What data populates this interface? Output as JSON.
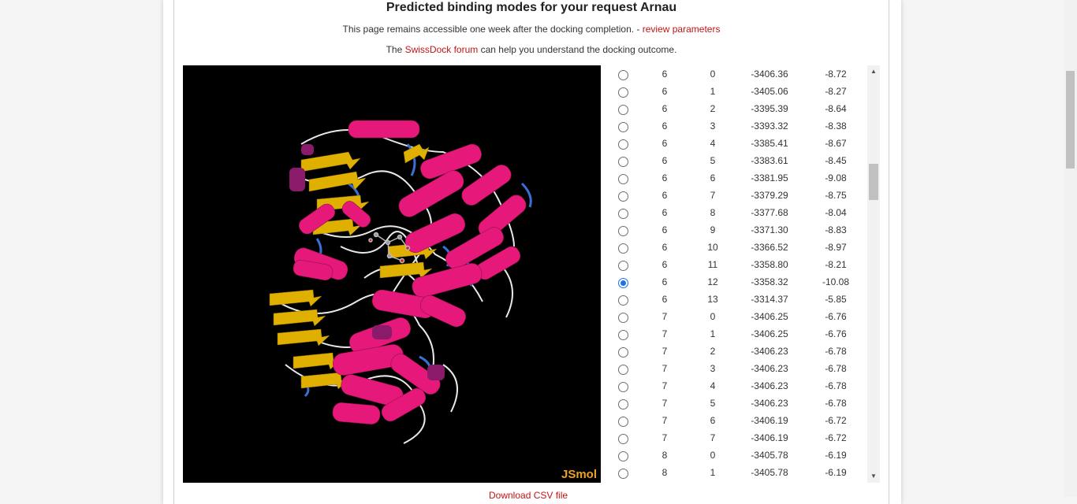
{
  "title": "Predicted binding modes for your request Arnau",
  "access_note": {
    "text": "This page remains accessible one week after the docking completion. - ",
    "link": "review parameters"
  },
  "forum_note": {
    "prefix": "The ",
    "link": "SwissDock forum",
    "suffix": " can help you understand the docking outcome."
  },
  "viewer": {
    "label": "JSmol"
  },
  "download_link": "Download CSV file",
  "rows": [
    {
      "cluster": "6",
      "element": "0",
      "fullfitness": "-3406.36",
      "dg": "-8.72",
      "checked": false
    },
    {
      "cluster": "6",
      "element": "1",
      "fullfitness": "-3405.06",
      "dg": "-8.27",
      "checked": false
    },
    {
      "cluster": "6",
      "element": "2",
      "fullfitness": "-3395.39",
      "dg": "-8.64",
      "checked": false
    },
    {
      "cluster": "6",
      "element": "3",
      "fullfitness": "-3393.32",
      "dg": "-8.38",
      "checked": false
    },
    {
      "cluster": "6",
      "element": "4",
      "fullfitness": "-3385.41",
      "dg": "-8.67",
      "checked": false
    },
    {
      "cluster": "6",
      "element": "5",
      "fullfitness": "-3383.61",
      "dg": "-8.45",
      "checked": false
    },
    {
      "cluster": "6",
      "element": "6",
      "fullfitness": "-3381.95",
      "dg": "-9.08",
      "checked": false
    },
    {
      "cluster": "6",
      "element": "7",
      "fullfitness": "-3379.29",
      "dg": "-8.75",
      "checked": false
    },
    {
      "cluster": "6",
      "element": "8",
      "fullfitness": "-3377.68",
      "dg": "-8.04",
      "checked": false
    },
    {
      "cluster": "6",
      "element": "9",
      "fullfitness": "-3371.30",
      "dg": "-8.83",
      "checked": false
    },
    {
      "cluster": "6",
      "element": "10",
      "fullfitness": "-3366.52",
      "dg": "-8.97",
      "checked": false
    },
    {
      "cluster": "6",
      "element": "11",
      "fullfitness": "-3358.80",
      "dg": "-8.21",
      "checked": false
    },
    {
      "cluster": "6",
      "element": "12",
      "fullfitness": "-3358.32",
      "dg": "-10.08",
      "checked": true
    },
    {
      "cluster": "6",
      "element": "13",
      "fullfitness": "-3314.37",
      "dg": "-5.85",
      "checked": false
    },
    {
      "cluster": "7",
      "element": "0",
      "fullfitness": "-3406.25",
      "dg": "-6.76",
      "checked": false
    },
    {
      "cluster": "7",
      "element": "1",
      "fullfitness": "-3406.25",
      "dg": "-6.76",
      "checked": false
    },
    {
      "cluster": "7",
      "element": "2",
      "fullfitness": "-3406.23",
      "dg": "-6.78",
      "checked": false
    },
    {
      "cluster": "7",
      "element": "3",
      "fullfitness": "-3406.23",
      "dg": "-6.78",
      "checked": false
    },
    {
      "cluster": "7",
      "element": "4",
      "fullfitness": "-3406.23",
      "dg": "-6.78",
      "checked": false
    },
    {
      "cluster": "7",
      "element": "5",
      "fullfitness": "-3406.23",
      "dg": "-6.78",
      "checked": false
    },
    {
      "cluster": "7",
      "element": "6",
      "fullfitness": "-3406.19",
      "dg": "-6.72",
      "checked": false
    },
    {
      "cluster": "7",
      "element": "7",
      "fullfitness": "-3406.19",
      "dg": "-6.72",
      "checked": false
    },
    {
      "cluster": "8",
      "element": "0",
      "fullfitness": "-3405.78",
      "dg": "-6.19",
      "checked": false
    },
    {
      "cluster": "8",
      "element": "1",
      "fullfitness": "-3405.78",
      "dg": "-6.19",
      "checked": false
    }
  ],
  "colors": {
    "link": "#c41414",
    "helix": "#e6197a",
    "sheet": "#e0b000",
    "coil": "#e8e8e8",
    "turn": "#3a6fd8",
    "radio_checked": "#1a73e8",
    "jsmol_label": "#f0a020"
  }
}
